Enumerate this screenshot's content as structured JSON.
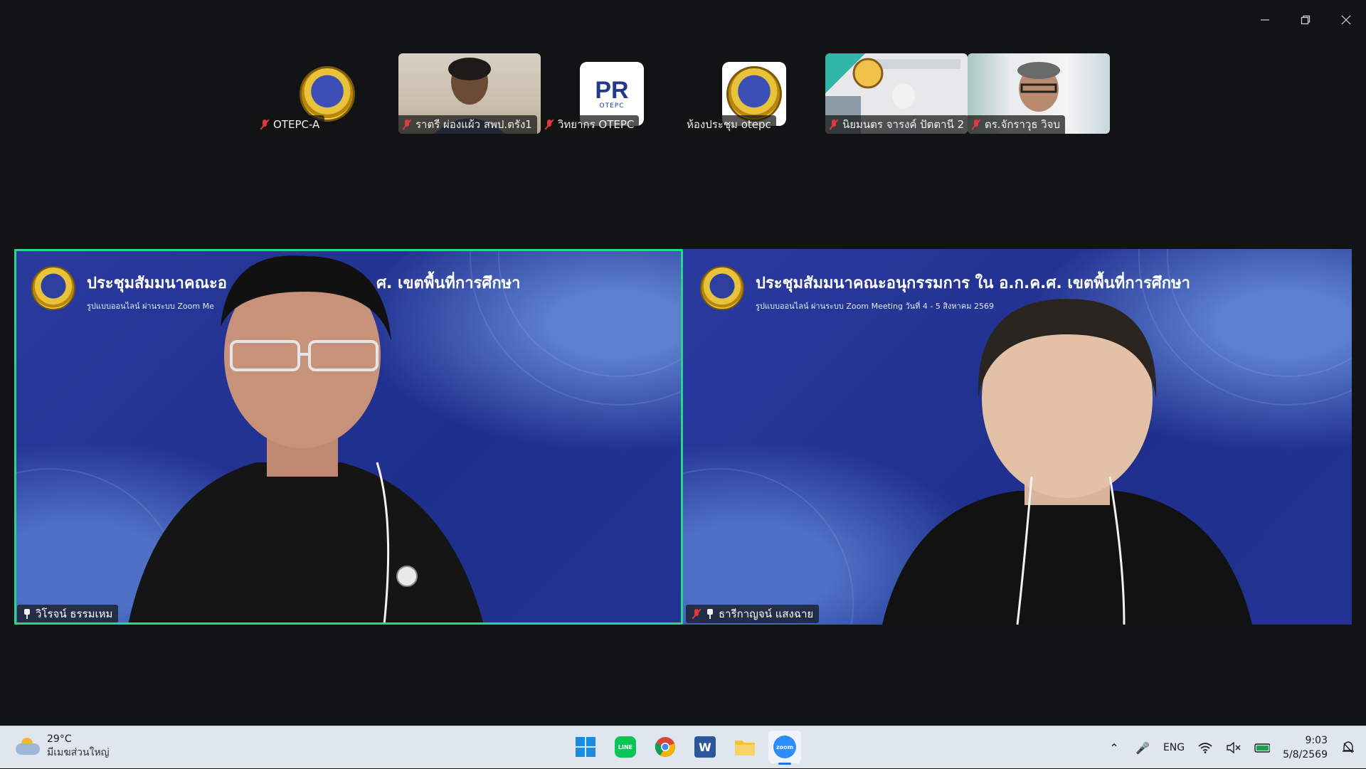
{
  "thumbnails": [
    {
      "name": "OTEPC-A",
      "muted": true
    },
    {
      "name": "ราตรี ผ่องแผ้ว สพป.ตรัง1",
      "muted": true
    },
    {
      "name": "วิทยากร OTEPC",
      "muted": true,
      "logo_text": "PR",
      "logo_sub": "OTEPC"
    },
    {
      "name": "ห้องประชุม otepc",
      "muted": false
    },
    {
      "name": "นิยมนตร จารงค์ ปัตตานี 2",
      "muted": true
    },
    {
      "name": "ดร.จักราวุธ วิจบ",
      "muted": true
    }
  ],
  "main_tiles": [
    {
      "title": "ประชุมสัมมนาคณะอ",
      "title_right": "ศ. เขตพื้นที่การศึกษา",
      "subtitle": "รูปแบบออนไลน์ ผ่านระบบ Zoom Me",
      "name": "วิโรจน์ ธรรมเหม",
      "muted": false,
      "active": true
    },
    {
      "title": "ประชุมสัมมนาคณะอนุกรรมการ ใน อ.ก.ค.ศ. เขตพื้นที่การศึกษา",
      "subtitle": "รูปแบบออนไลน์ ผ่านระบบ Zoom Meeting  วันที่ 4 - 5 สิงหาคม 2569",
      "name": "ธารีกาญจน์ แสงฉาย",
      "muted": true,
      "active": false
    }
  ],
  "taskbar": {
    "weather_temp": "29°C",
    "weather_desc": "มีเมฆส่วนใหญ่",
    "language": "ENG",
    "time": "9:03",
    "date": "5/8/2569",
    "apps": [
      "windows-start",
      "line",
      "chrome",
      "word",
      "file-explorer",
      "zoom"
    ],
    "zoom_label": "zoom",
    "line_label": "LINE",
    "word_label": "W"
  },
  "colors": {
    "active_speaker": "#2bd48a",
    "tile_bg": "#23348f",
    "muted_red": "#e0393e"
  }
}
